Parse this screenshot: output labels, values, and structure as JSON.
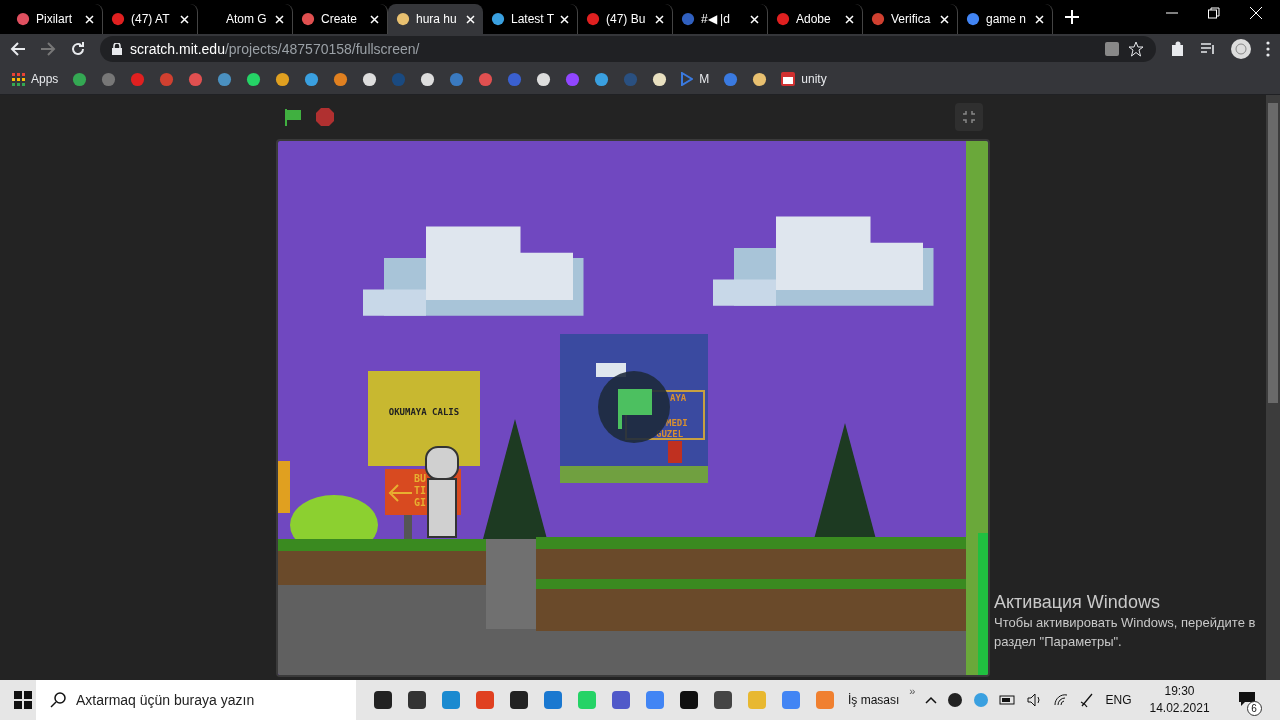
{
  "tabs": [
    {
      "title": "Pixilart",
      "selected": false
    },
    {
      "title": "(47) AT",
      "selected": false
    },
    {
      "title": "Atom G",
      "selected": false
    },
    {
      "title": "Create",
      "selected": false
    },
    {
      "title": "hura hu",
      "selected": true
    },
    {
      "title": "Latest T",
      "selected": false
    },
    {
      "title": "(47) Bu",
      "selected": false
    },
    {
      "title": "#◀ |d",
      "selected": false
    },
    {
      "title": "Adobe",
      "selected": false
    },
    {
      "title": "Verifica",
      "selected": false
    },
    {
      "title": "game n",
      "selected": false
    }
  ],
  "address_bar": {
    "host": "scratch.mit.edu",
    "path": "/projects/487570158/fullscreen/"
  },
  "bookmarks": {
    "apps": "Apps",
    "m": "M",
    "unity": "unity"
  },
  "stage": {
    "sign_text": "OKUMAYA CALIS",
    "arrow_sign_lines": [
      "BU",
      "TI",
      "GI"
    ],
    "inset_lines": [
      "AYA",
      "MEDI",
      "GUZEL"
    ]
  },
  "activation_notice": {
    "title": "Активация Windows",
    "body": "Чтобы активировать Windows, перейдите в раздел \"Параметры\"."
  },
  "taskbar": {
    "search_placeholder": "Axtarmaq üçün buraya yazın",
    "desktop_label": "İş masası",
    "overflow": "»",
    "language": "ENG",
    "time": "19:30",
    "date": "14.02.2021",
    "notifications": "6"
  }
}
